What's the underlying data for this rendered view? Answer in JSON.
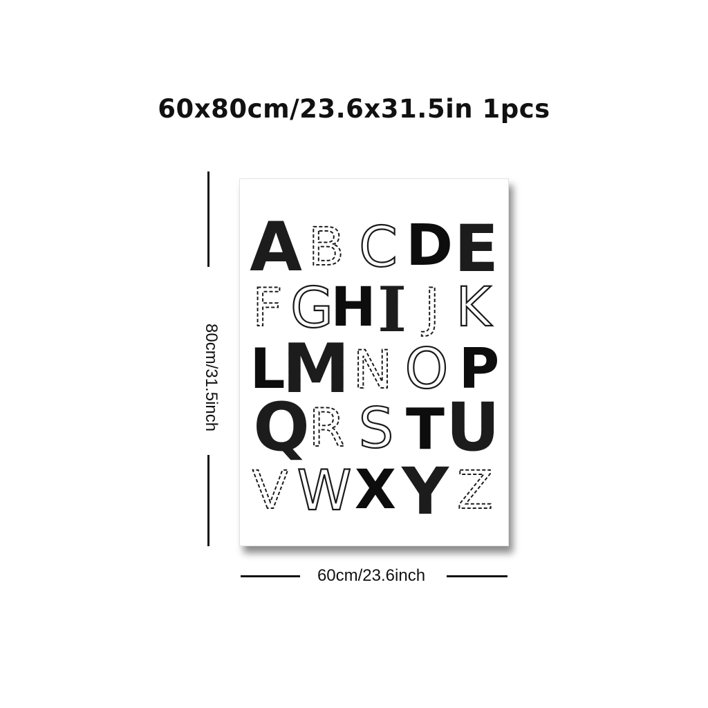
{
  "title": "60x80cm/23.6x31.5in 1pcs",
  "height_label": "80cm/31.5inch",
  "width_label": "60cm/23.6inch",
  "poster": {
    "letters": [
      {
        "ch": "A",
        "style": "stamp"
      },
      {
        "ch": "B",
        "style": "thin-dashed"
      },
      {
        "ch": "C",
        "style": "thin"
      },
      {
        "ch": "D",
        "style": "bold"
      },
      {
        "ch": "E",
        "style": "stamp"
      },
      {
        "ch": "F",
        "style": "dashed"
      },
      {
        "ch": "G",
        "style": "thin"
      },
      {
        "ch": "H",
        "style": "bold"
      },
      {
        "ch": "I",
        "style": "stamp-serif"
      },
      {
        "ch": "J",
        "style": "dashed"
      },
      {
        "ch": "K",
        "style": "thin"
      },
      {
        "ch": "L",
        "style": "bold"
      },
      {
        "ch": "M",
        "style": "stamp"
      },
      {
        "ch": "N",
        "style": "dashed"
      },
      {
        "ch": "O",
        "style": "thin"
      },
      {
        "ch": "P",
        "style": "bold"
      },
      {
        "ch": "Q",
        "style": "stamp"
      },
      {
        "ch": "R",
        "style": "thin-dashed"
      },
      {
        "ch": "S",
        "style": "thin"
      },
      {
        "ch": "T",
        "style": "bold"
      },
      {
        "ch": "U",
        "style": "stamp"
      },
      {
        "ch": "V",
        "style": "dashed"
      },
      {
        "ch": "W",
        "style": "thin"
      },
      {
        "ch": "X",
        "style": "bold"
      },
      {
        "ch": "Y",
        "style": "stamp"
      },
      {
        "ch": "Z",
        "style": "dashed"
      }
    ]
  }
}
